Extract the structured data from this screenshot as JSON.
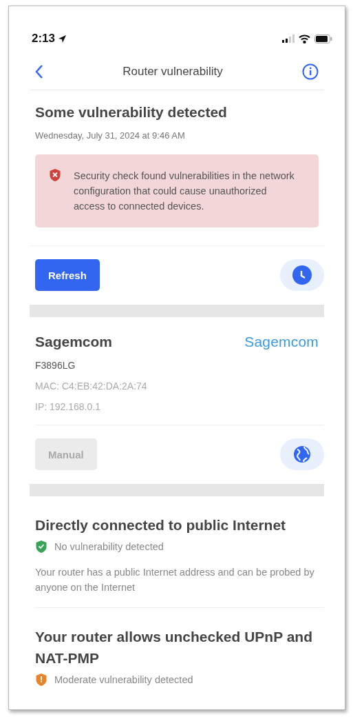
{
  "status_bar": {
    "time": "2:13"
  },
  "nav": {
    "title": "Router vulnerability"
  },
  "summary": {
    "title": "Some vulnerability detected",
    "date": "Wednesday, July 31, 2024 at 9:46 AM",
    "alert": {
      "kind": "danger",
      "text": "Security check found vulnerabilities in the network configuration that could cause unauthorized access to connected devices."
    },
    "button": {
      "label": "Refresh",
      "disabled": false
    }
  },
  "router": {
    "name": "Sagemcom",
    "logo": "Sagemcom",
    "model": "F3896LG",
    "mac": "MAC: C4:EB:42:DA:2A:74",
    "ip": "IP: 192.168.0.1",
    "button": {
      "label": "Manual",
      "disabled": true
    }
  },
  "checks": [
    {
      "title": "Directly connected to public Internet",
      "kind": "ok",
      "status": "No vulnerability detected",
      "description": "Your router has a public Internet address and can be probed by anyone on the Internet"
    },
    {
      "title": "Your router allows unchecked UPnP and NAT-PMP",
      "kind": "moderate",
      "status": "Moderate vulnerability detected"
    }
  ]
}
